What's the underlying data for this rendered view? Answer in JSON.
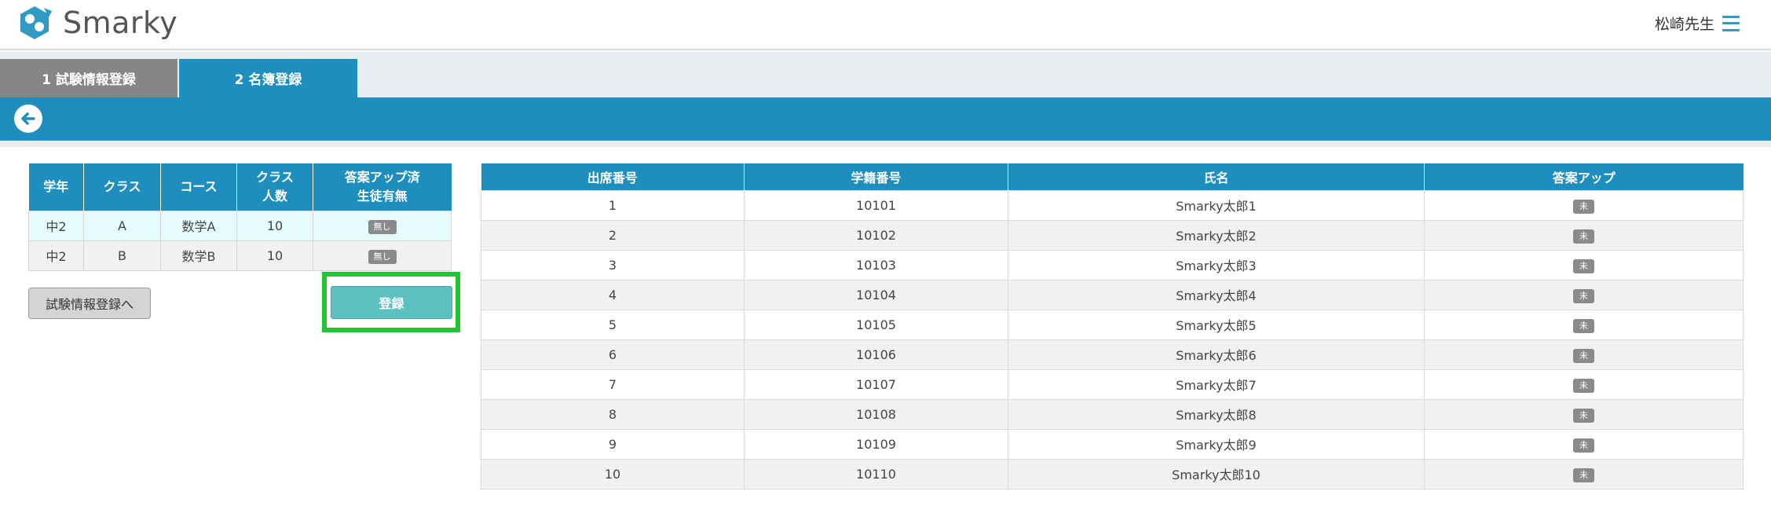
{
  "app": {
    "logo_text": "Smarky"
  },
  "header": {
    "user_name": "松崎先生"
  },
  "tabs": [
    {
      "label": "1  試験情報登録"
    },
    {
      "label": "2  名簿登録"
    }
  ],
  "colors": {
    "accent": "#1e8ebe",
    "tab_inactive": "#868686",
    "register_button": "#5cbfc0",
    "highlight": "#21c431"
  },
  "class_table": {
    "headers": [
      "学年",
      "クラス",
      "コース",
      "クラス\n人数",
      "答案アップ済\n生徒有無"
    ],
    "rows": [
      {
        "grade": "中2",
        "class": "A",
        "course": "数学A",
        "count": "10",
        "status": "無し"
      },
      {
        "grade": "中2",
        "class": "B",
        "course": "数学B",
        "count": "10",
        "status": "無し"
      }
    ]
  },
  "buttons": {
    "exam_info": "試験情報登録へ",
    "register": "登録"
  },
  "student_table": {
    "headers": [
      "出席番号",
      "学籍番号",
      "氏名",
      "答案アップ"
    ],
    "rows": [
      {
        "no": "1",
        "id": "10101",
        "name": "Smarky太郎1",
        "status": "未"
      },
      {
        "no": "2",
        "id": "10102",
        "name": "Smarky太郎2",
        "status": "未"
      },
      {
        "no": "3",
        "id": "10103",
        "name": "Smarky太郎3",
        "status": "未"
      },
      {
        "no": "4",
        "id": "10104",
        "name": "Smarky太郎4",
        "status": "未"
      },
      {
        "no": "5",
        "id": "10105",
        "name": "Smarky太郎5",
        "status": "未"
      },
      {
        "no": "6",
        "id": "10106",
        "name": "Smarky太郎6",
        "status": "未"
      },
      {
        "no": "7",
        "id": "10107",
        "name": "Smarky太郎7",
        "status": "未"
      },
      {
        "no": "8",
        "id": "10108",
        "name": "Smarky太郎8",
        "status": "未"
      },
      {
        "no": "9",
        "id": "10109",
        "name": "Smarky太郎9",
        "status": "未"
      },
      {
        "no": "10",
        "id": "10110",
        "name": "Smarky太郎10",
        "status": "未"
      }
    ]
  }
}
